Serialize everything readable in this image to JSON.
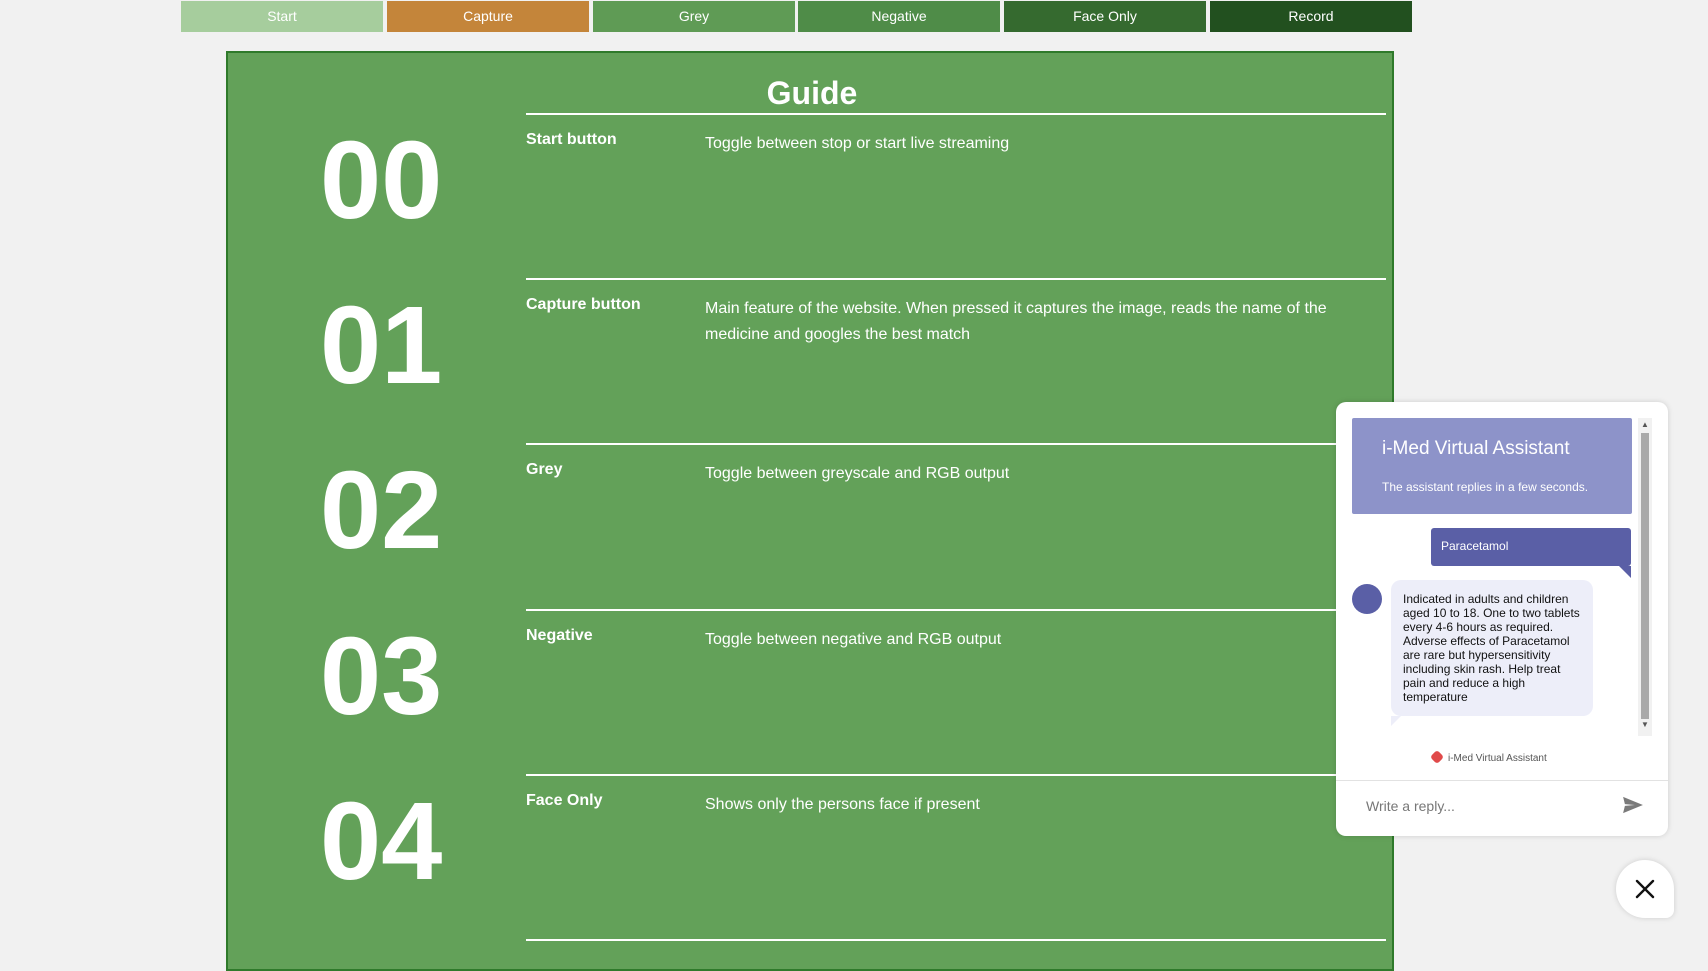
{
  "toolbar": {
    "buttons": [
      {
        "label": "Start",
        "color": "#a6cd9d"
      },
      {
        "label": "Capture",
        "color": "#c4853a"
      },
      {
        "label": "Grey",
        "color": "#5f9b55"
      },
      {
        "label": "Negative",
        "color": "#4f8c48"
      },
      {
        "label": "Face Only",
        "color": "#356a2f"
      },
      {
        "label": "Record",
        "color": "#22501f"
      }
    ]
  },
  "guide": {
    "title": "Guide",
    "items": [
      {
        "number": "00",
        "title": "Start button",
        "description": "Toggle between stop or start live streaming"
      },
      {
        "number": "01",
        "title": "Capture button",
        "description": "Main feature of the website. When pressed it captures the image, reads the name of the medicine and googles the best match"
      },
      {
        "number": "02",
        "title": "Grey",
        "description": "Toggle between greyscale and RGB output"
      },
      {
        "number": "03",
        "title": "Negative",
        "description": "Toggle between negative and RGB output"
      },
      {
        "number": "04",
        "title": "Face Only",
        "description": "Shows only the persons face if present"
      }
    ]
  },
  "chat": {
    "title": "i-Med Virtual Assistant",
    "subtitle": "The assistant replies in a few seconds.",
    "user_message": "Paracetamol",
    "bot_message": "Indicated in adults and children aged 10 to 18. One to two tablets every 4-6 hours as required. Adverse effects of Paracetamol are rare but hypersensitivity including skin rash. Help treat pain and reduce a high temperature",
    "powered_by": "i-Med Virtual Assistant",
    "reply_placeholder": "Write a reply..."
  },
  "colors": {
    "guide_bg": "#63a159",
    "chat_header": "#8d93c9",
    "user_bubble": "#5a5fa6"
  }
}
